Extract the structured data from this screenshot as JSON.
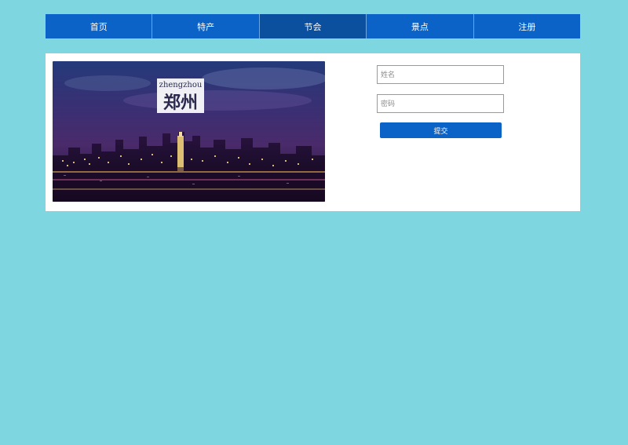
{
  "nav": {
    "items": [
      {
        "label": "首页",
        "active": false
      },
      {
        "label": "特产",
        "active": false
      },
      {
        "label": "节会",
        "active": true
      },
      {
        "label": "景点",
        "active": false
      },
      {
        "label": "注册",
        "active": false
      }
    ]
  },
  "hero": {
    "logo_latin": "zhengzhou",
    "logo_chinese": "郑州"
  },
  "form": {
    "name_placeholder": "姓名",
    "password_placeholder": "密码",
    "submit_label": "提交"
  },
  "colors": {
    "page_background": "#7dd6e0",
    "nav_background": "#0b63c8",
    "nav_active_background": "#0b4f9f",
    "button_background": "#0b63c8"
  }
}
